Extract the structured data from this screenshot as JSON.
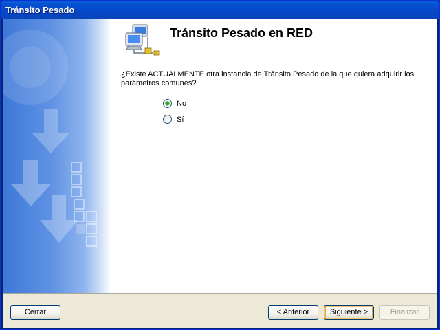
{
  "window": {
    "title": "Tránsito Pesado"
  },
  "header": {
    "title": "Tránsito Pesado en RED",
    "icon": "network-computer-icon"
  },
  "question": {
    "text": "¿Existe ACTUALMENTE otra instancia de Tránsito Pesado de la que quiera adquirir los parámetros comunes?"
  },
  "options": [
    {
      "label": "No",
      "checked": true
    },
    {
      "label": "Sí",
      "checked": false
    }
  ],
  "buttons": {
    "close": "Cerrar",
    "back": "< Anterior",
    "next": "Siguiente >",
    "finish": "Finalizar"
  },
  "colors": {
    "titlebar": "#0653d2",
    "panel_blue": "#3d78d8",
    "bottom_bar": "#ece9d8",
    "radio_dot": "#2fa52f"
  }
}
